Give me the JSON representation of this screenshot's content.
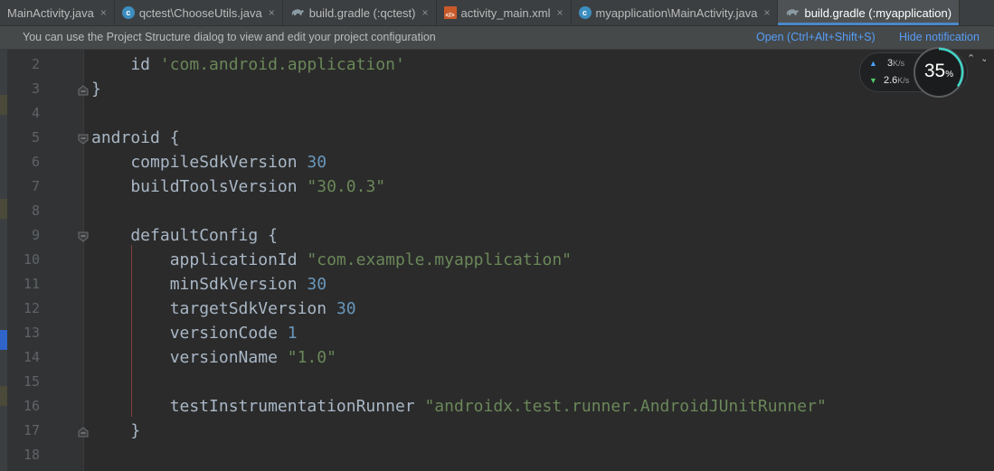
{
  "tabs": [
    {
      "label": "MainActivity.java",
      "icon": "java-class-icon",
      "active": false
    },
    {
      "label": "qctest\\ChooseUtils.java",
      "icon": "java-class-icon",
      "active": false
    },
    {
      "label": "build.gradle (:qctest)",
      "icon": "gradle-icon",
      "active": false
    },
    {
      "label": "activity_main.xml",
      "icon": "xml-layout-icon",
      "active": false
    },
    {
      "label": "myapplication\\MainActivity.java",
      "icon": "java-class-icon",
      "active": false
    },
    {
      "label": "build.gradle (:myapplication)",
      "icon": "gradle-icon",
      "active": true
    }
  ],
  "tab_close_glyph": "×",
  "notification": {
    "message": "You can use the Project Structure dialog to view and edit your project configuration",
    "open_link": "Open (Ctrl+Alt+Shift+S)",
    "hide_link": "Hide notification"
  },
  "perf_widget": {
    "upload": "3",
    "upload_unit": "K/s",
    "download": "2.6",
    "download_unit": "K/s",
    "percent": "35",
    "percent_unit": "%",
    "percent_value": 0.35
  },
  "code_lines": [
    {
      "n": "2",
      "parts": [
        [
          "",
          "    id "
        ],
        [
          "str",
          "'com.android.application'"
        ]
      ]
    },
    {
      "n": "3",
      "parts": [
        [
          "",
          "}"
        ]
      ]
    },
    {
      "n": "4",
      "parts": []
    },
    {
      "n": "5",
      "parts": [
        [
          "",
          "android {"
        ]
      ]
    },
    {
      "n": "6",
      "parts": [
        [
          "",
          "    compileSdkVersion "
        ],
        [
          "num",
          "30"
        ]
      ]
    },
    {
      "n": "7",
      "parts": [
        [
          "",
          "    buildToolsVersion "
        ],
        [
          "str",
          "\"30.0.3\""
        ]
      ]
    },
    {
      "n": "8",
      "parts": []
    },
    {
      "n": "9",
      "parts": [
        [
          "",
          "    defaultConfig {"
        ]
      ]
    },
    {
      "n": "10",
      "parts": [
        [
          "",
          "        applicationId "
        ],
        [
          "str",
          "\"com.example.myapplication\""
        ]
      ]
    },
    {
      "n": "11",
      "parts": [
        [
          "",
          "        minSdkVersion "
        ],
        [
          "num",
          "30"
        ]
      ]
    },
    {
      "n": "12",
      "parts": [
        [
          "",
          "        targetSdkVersion "
        ],
        [
          "num",
          "30"
        ]
      ]
    },
    {
      "n": "13",
      "parts": [
        [
          "",
          "        versionCode "
        ],
        [
          "num",
          "1"
        ]
      ]
    },
    {
      "n": "14",
      "parts": [
        [
          "",
          "        versionName "
        ],
        [
          "str",
          "\"1.0\""
        ]
      ]
    },
    {
      "n": "15",
      "parts": []
    },
    {
      "n": "16",
      "parts": [
        [
          "",
          "        testInstrumentationRunner "
        ],
        [
          "str",
          "\"androidx.test.runner.AndroidJUnitRunner\""
        ]
      ]
    },
    {
      "n": "17",
      "parts": [
        [
          "",
          "    }"
        ]
      ]
    },
    {
      "n": "18",
      "parts": []
    }
  ],
  "colors": {
    "editor_bg": "#2b2b2b",
    "keyword_text": "#a9b7c6",
    "string": "#6a8759",
    "number": "#6897bb",
    "link": "#589df6",
    "active_tab_underline": "#4a88c7"
  }
}
